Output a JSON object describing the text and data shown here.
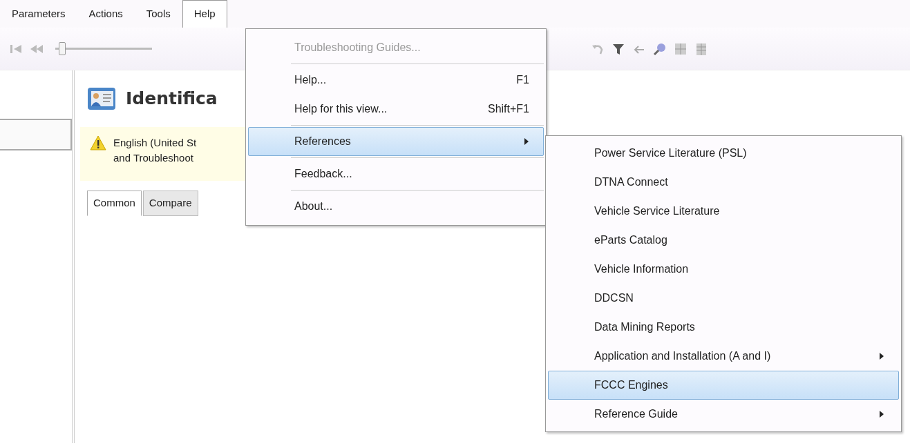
{
  "menubar": [
    {
      "label": "Parameters",
      "selected": false
    },
    {
      "label": "Actions",
      "selected": false
    },
    {
      "label": "Tools",
      "selected": false
    },
    {
      "label": "Help",
      "selected": true
    }
  ],
  "toolbar": {
    "slider": {
      "level": 0.04
    }
  },
  "page": {
    "title": "Identifica",
    "warning": [
      "English (United St",
      "and Troubleshoot"
    ]
  },
  "tabs": [
    {
      "label": "Common",
      "selected": true
    },
    {
      "label": "Compare",
      "selected": false
    }
  ],
  "help_menu": [
    {
      "kind": "item",
      "label": "Troubleshooting Guides...",
      "disabled": true,
      "selected": false,
      "submenu": false
    },
    {
      "kind": "separator"
    },
    {
      "kind": "item",
      "label": "Help...",
      "shortcut": "F1",
      "disabled": false,
      "selected": false,
      "submenu": false
    },
    {
      "kind": "item",
      "label": "Help for this view...",
      "shortcut": "Shift+F1",
      "disabled": false,
      "selected": false,
      "submenu": false
    },
    {
      "kind": "separator"
    },
    {
      "kind": "item",
      "label": "References",
      "disabled": false,
      "selected": true,
      "submenu": true
    },
    {
      "kind": "separator"
    },
    {
      "kind": "item",
      "label": "Feedback...",
      "disabled": false,
      "selected": false,
      "submenu": false
    },
    {
      "kind": "separator"
    },
    {
      "kind": "item",
      "label": "About...",
      "disabled": false,
      "selected": false,
      "submenu": false
    }
  ],
  "references_menu": [
    {
      "label": "Power Service Literature (PSL)",
      "selected": false,
      "submenu": false
    },
    {
      "label": "DTNA Connect",
      "selected": false,
      "submenu": false
    },
    {
      "label": "Vehicle Service Literature",
      "selected": false,
      "submenu": false
    },
    {
      "label": "eParts Catalog",
      "selected": false,
      "submenu": false
    },
    {
      "label": "Vehicle Information",
      "selected": false,
      "submenu": false
    },
    {
      "label": "DDCSN",
      "selected": false,
      "submenu": false
    },
    {
      "label": "Data Mining Reports",
      "selected": false,
      "submenu": false
    },
    {
      "label": "Application and Installation (A and I)",
      "selected": false,
      "submenu": true
    },
    {
      "label": "FCCC Engines",
      "selected": true,
      "submenu": false
    },
    {
      "label": "Reference Guide",
      "selected": false,
      "submenu": true
    }
  ]
}
